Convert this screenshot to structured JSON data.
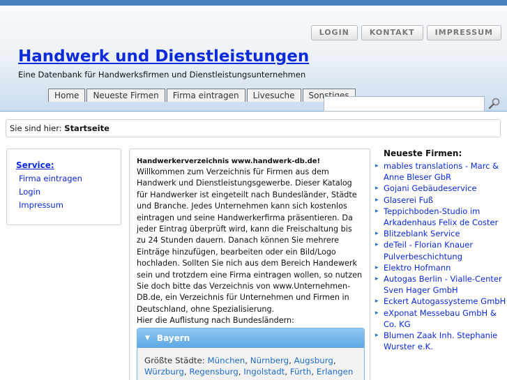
{
  "topnav": [
    "LOGIN",
    "KONTAKT",
    "IMPRESSUM"
  ],
  "site": {
    "title": "Handwerk und Dienstleistungen",
    "subtitle": "Eine Datenbank für Handwerksfirmen und Dienstleistungsunternehmen"
  },
  "tabs": [
    "Home",
    "Neueste Firmen",
    "Firma eintragen",
    "Livesuche",
    "Sonstiges"
  ],
  "search": {
    "value": ""
  },
  "breadcrumb": {
    "prefix": "Sie sind hier:",
    "current": "Startseite"
  },
  "service": {
    "title": "Service:",
    "links": [
      "Firma eintragen",
      "Login",
      "Impressum"
    ]
  },
  "main": {
    "intro_title": "Handwerkerverzeichnis www.handwerk-db.de!",
    "intro": "Willkommen zum Verzeichnis für Firmen aus dem Handwerk und Dienstleistungsgewerbe. Dieser Katalog für Handwerker ist eingeteilt nach Bundesländer, Städte und Branche. Jedes Unternehmen kann sich kostenlos eintragen und seine Handwerkerfirma präsentieren. Da jeder Eintrag überprüft wird, kann die Freischaltung bis zu 24 Stunden dauern. Danach können Sie mehrere Einträge hinzufügen, bearbeiten oder ein Bild/Logo hochladen. Sollten Sie nich aus dem Bereich Handewerk sein und trotzdem eine Firma eintragen wollen, so nutzen Sie doch bitte das Verzeichnis von www.Unternehmen-DB.de, ein Verzeichnis für Unternehmen und Firmen in Deutschland, ohne Spezialisierung.",
    "list_intro": "Hier die Auflistung nach Bundesländern:",
    "accordion": {
      "title": "Bayern",
      "cities_label": "Größte Städte:",
      "cities": [
        "München",
        "Nürnberg",
        "Augsburg",
        "Würzburg",
        "Regensburg",
        "Ingolstadt",
        "Fürth",
        "Erlangen"
      ]
    }
  },
  "newest": {
    "title": "Neueste Firmen:",
    "items": [
      "mables translations - Marc & Anne Bleser GbR",
      "Gojani Gebäudeservice",
      "Glaserei Fuß",
      "Teppichboden-Studio im Arkadenhaus Felix de Coster",
      "Blitzeblank Service",
      "deTeil - Florian Knauer Pulverbeschichtung",
      "Elektro Hofmann",
      "Autogas Berlin - Vialle-Center Sven Hager GmbH",
      "Eckert Autogassysteme GmbH",
      "eXponat Messebau GmbH & Co. KG",
      "Blumen Zaak Inh. Stephanie Wurster e.K."
    ]
  },
  "colors": {
    "link": "#0b2ad8",
    "accent": "#4a7fc0",
    "accordion": "#5ea8e3"
  }
}
